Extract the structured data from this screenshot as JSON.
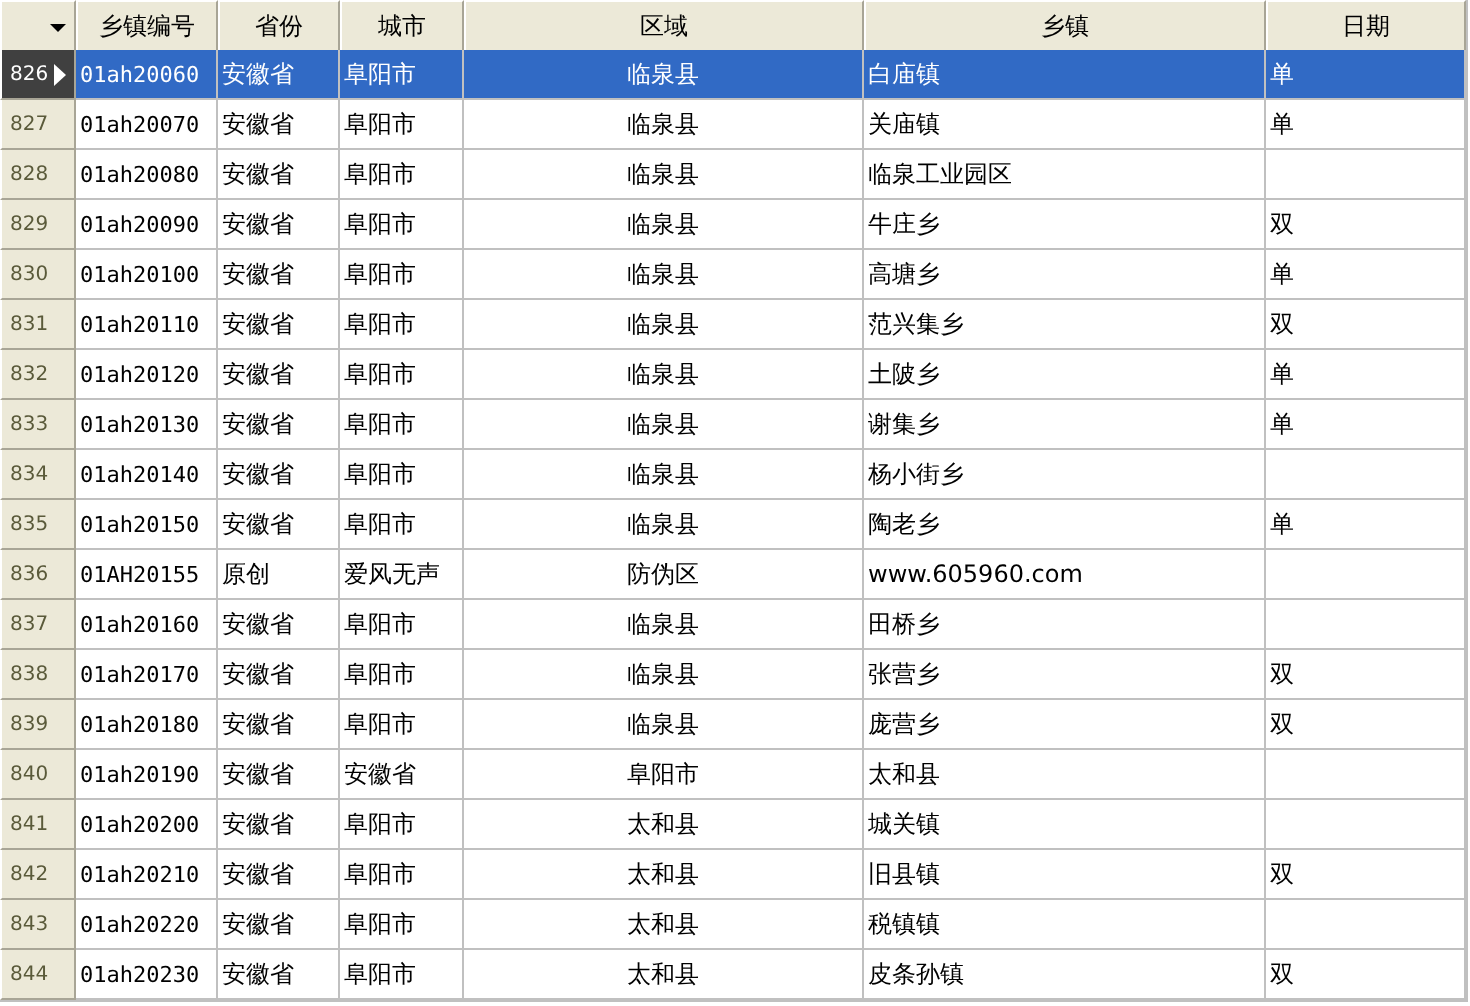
{
  "columns": [
    "乡镇编号",
    "省份",
    "城市",
    "区域",
    "乡镇",
    "日期"
  ],
  "rows": [
    {
      "num": "826",
      "code": "01ah20060",
      "province": "安徽省",
      "city": "阜阳市",
      "district": "临泉县",
      "town": "白庙镇",
      "date": "单",
      "selected": true
    },
    {
      "num": "827",
      "code": "01ah20070",
      "province": "安徽省",
      "city": "阜阳市",
      "district": "临泉县",
      "town": "关庙镇",
      "date": "单",
      "selected": false
    },
    {
      "num": "828",
      "code": "01ah20080",
      "province": "安徽省",
      "city": "阜阳市",
      "district": "临泉县",
      "town": "临泉工业园区",
      "selected": false
    },
    {
      "num": "829",
      "code": "01ah20090",
      "province": "安徽省",
      "city": "阜阳市",
      "district": "临泉县",
      "town": "牛庄乡",
      "date": "双",
      "selected": false
    },
    {
      "num": "830",
      "code": "01ah20100",
      "province": "安徽省",
      "city": "阜阳市",
      "district": "临泉县",
      "town": "高塘乡",
      "date": "单",
      "selected": false
    },
    {
      "num": "831",
      "code": "01ah20110",
      "province": "安徽省",
      "city": "阜阳市",
      "district": "临泉县",
      "town": "范兴集乡",
      "date": "双",
      "selected": false
    },
    {
      "num": "832",
      "code": "01ah20120",
      "province": "安徽省",
      "city": "阜阳市",
      "district": "临泉县",
      "town": "土陂乡",
      "date": "单",
      "selected": false
    },
    {
      "num": "833",
      "code": "01ah20130",
      "province": "安徽省",
      "city": "阜阳市",
      "district": "临泉县",
      "town": "谢集乡",
      "date": "单",
      "selected": false
    },
    {
      "num": "834",
      "code": "01ah20140",
      "province": "安徽省",
      "city": "阜阳市",
      "district": "临泉县",
      "town": "杨小街乡",
      "selected": false
    },
    {
      "num": "835",
      "code": "01ah20150",
      "province": "安徽省",
      "city": "阜阳市",
      "district": "临泉县",
      "town": "陶老乡",
      "date": "单",
      "selected": false
    },
    {
      "num": "836",
      "code": "01AH20155",
      "province": "原创",
      "city": "爱风无声",
      "district": "防伪区",
      "town": "www.605960.com",
      "selected": false
    },
    {
      "num": "837",
      "code": "01ah20160",
      "province": "安徽省",
      "city": "阜阳市",
      "district": "临泉县",
      "town": "田桥乡",
      "selected": false
    },
    {
      "num": "838",
      "code": "01ah20170",
      "province": "安徽省",
      "city": "阜阳市",
      "district": "临泉县",
      "town": "张营乡",
      "date": "双",
      "selected": false
    },
    {
      "num": "839",
      "code": "01ah20180",
      "province": "安徽省",
      "city": "阜阳市",
      "district": "临泉县",
      "town": "庞营乡",
      "date": "双",
      "selected": false
    },
    {
      "num": "840",
      "code": "01ah20190",
      "province": "安徽省",
      "city": "安徽省",
      "district": "阜阳市",
      "town": "太和县",
      "selected": false
    },
    {
      "num": "841",
      "code": "01ah20200",
      "province": "安徽省",
      "city": "阜阳市",
      "district": "太和县",
      "town": "城关镇",
      "selected": false
    },
    {
      "num": "842",
      "code": "01ah20210",
      "province": "安徽省",
      "city": "阜阳市",
      "district": "太和县",
      "town": "旧县镇",
      "date": "双",
      "selected": false
    },
    {
      "num": "843",
      "code": "01ah20220",
      "province": "安徽省",
      "city": "阜阳市",
      "district": "太和县",
      "town": "税镇镇",
      "selected": false
    },
    {
      "num": "844",
      "code": "01ah20230",
      "province": "安徽省",
      "city": "阜阳市",
      "district": "太和县",
      "town": "皮条孙镇",
      "date": "双",
      "selected": false
    }
  ]
}
